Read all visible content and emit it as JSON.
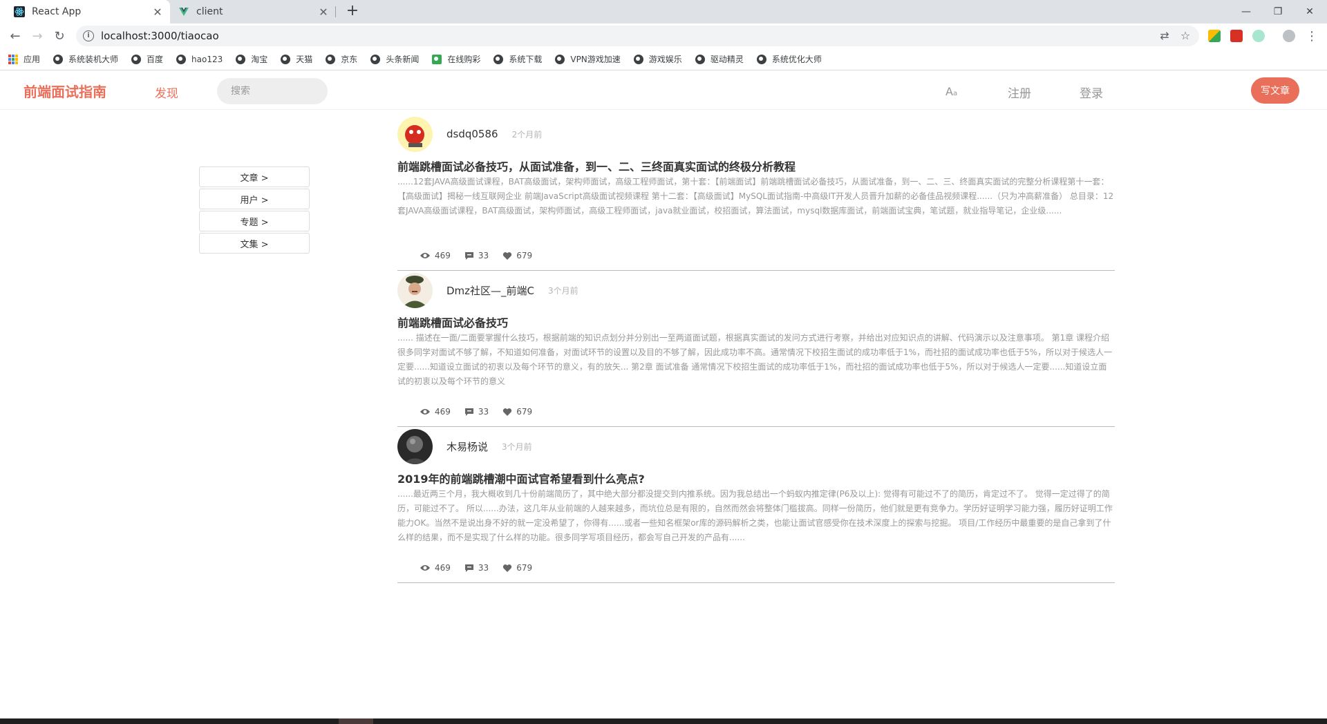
{
  "browser": {
    "tabs": [
      {
        "title": "React App",
        "active": true,
        "icon": "react-icon"
      },
      {
        "title": "client",
        "active": false,
        "icon": "vue-icon"
      }
    ],
    "url": "localhost:3000/tiaocao",
    "bookmarks": [
      "应用",
      "系统装机大师",
      "百度",
      "hao123",
      "淘宝",
      "天猫",
      "京东",
      "头条新闻",
      "在线购彩",
      "系统下载",
      "VPN游戏加速",
      "游戏娱乐",
      "驱动精灵",
      "系统优化大师"
    ]
  },
  "header": {
    "logo": "前端面试指南",
    "discover": "发现",
    "search_placeholder": "搜索",
    "font_toggle": "A",
    "font_toggle_small": "a",
    "register": "注册",
    "login": "登录",
    "write": "写文章"
  },
  "filters": [
    "文章 >",
    "用户 >",
    "专题 >",
    "文集 >"
  ],
  "posts": [
    {
      "author": "dsdq0586",
      "time": "2个月前",
      "title": "前端跳槽面试必备技巧，从面试准备，到一、二、三终面真实面试的终极分析教程",
      "body": "......12套JAVA高级面试课程，BAT高级面试，架构师面试，高级工程师面试，第十套：【前端面试】前端跳槽面试必备技巧，从面试准备，到一、二、三、终面真实面试的完整分析课程第十一套：【高级面试】揭秘一线互联网企业 前端JavaScript高级面试视频课程 第十二套：【高级面试】MySQL面试指南-中高级IT开发人员晋升加薪的必备佳品视频课程......（只为冲高薪准备） 总目录：12套JAVA高级面试课程，BAT高级面试，架构师面试，高级工程师面试，java就业面试，校招面试，算法面试，mysql数据库面试，前端面试宝典，笔试题，就业指导笔记，企业级......",
      "views": "469",
      "comments": "33",
      "likes": "679"
    },
    {
      "author": "Dmz社区—_前端C",
      "time": "3个月前",
      "title": "前端跳槽面试必备技巧",
      "body": "...... 描述在一面/二面要掌握什么技巧，根据前端的知识点划分并分别出一至两道面试题，根据真实面试的发问方式进行考察，并给出对应知识点的讲解、代码演示以及注意事项。 第1章 课程介绍 很多同学对面试不够了解，不知道如何准备，对面试环节的设置以及目的不够了解，因此成功率不高。通常情况下校招生面试的成功率低于1%，而社招的面试成功率也低于5%，所以对于候选人一定要......知道设立面试的初衷以及每个环节的意义，有的放矢... 第2章 面试准备 通常情况下校招生面试的成功率低于1%，而社招的面试成功率也低于5%，所以对于候选人一定要......知道设立面试的初衷以及每个环节的意义",
      "views": "469",
      "comments": "33",
      "likes": "679"
    },
    {
      "author": "木易杨说",
      "time": "3个月前",
      "title": "2019年的前端跳槽潮中面试官希望看到什么亮点?",
      "body": "......最近两三个月，我大概收到几十份前端简历了，其中绝大部分都没提交到内推系统。因为我总结出一个蚂蚁内推定律(P6及以上): 觉得有可能过不了的简历，肯定过不了。 觉得一定过得了的简历，可能过不了。 所以......办法，这几年从业前端的人越来越多，而坑位总是有限的，自然而然会将整体门槛拔高。同样一份简历，他们就是更有竞争力。学历好证明学习能力强，履历好证明工作能力OK。当然不是说出身不好的就一定没希望了，你得有......或者一些知名框架or库的源码解析之类，也能让面试官感受你在技术深度上的探索与挖掘。 项目/工作经历中最重要的是自己拿到了什么样的结果，而不是实现了什么样的功能。很多同学写项目经历，都会写自己开发的产品有......",
      "views": "469",
      "comments": "33",
      "likes": "679"
    }
  ]
}
